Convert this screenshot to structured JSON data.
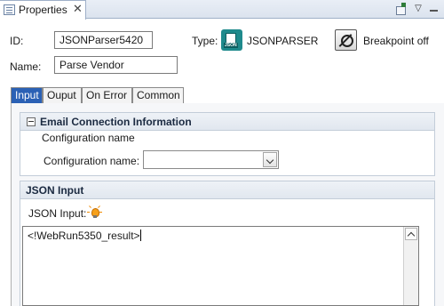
{
  "view": {
    "tab_title": "Properties",
    "close_glyph": "✕",
    "icons": [
      "properties-icon",
      "pin-icon",
      "view-menu-icon",
      "minimize-icon"
    ]
  },
  "header": {
    "id_label": "ID:",
    "id_value": "JSONParser5420",
    "type_label": "Type:",
    "type_value": "JSONPARSER",
    "name_label": "Name:",
    "name_value": "Parse Vendor",
    "breakpoint_label": "Breakpoint off"
  },
  "tabs": [
    {
      "label": "Input",
      "active": true
    },
    {
      "label": "Ouput",
      "active": false
    },
    {
      "label": "On Error",
      "active": false
    },
    {
      "label": "Common",
      "active": false
    }
  ],
  "email_section": {
    "title": "Email Connection Information",
    "sub_heading": "Configuration name",
    "field_label": "Configuration name:",
    "field_value": ""
  },
  "json_section": {
    "title": "JSON Input",
    "field_label": "JSON Input:",
    "value": "<!WebRun5350_result>"
  },
  "colors": {
    "active_tab": "#2b61b5",
    "type_icon": "#1f8a8c",
    "bulb": "#f6a01a"
  }
}
